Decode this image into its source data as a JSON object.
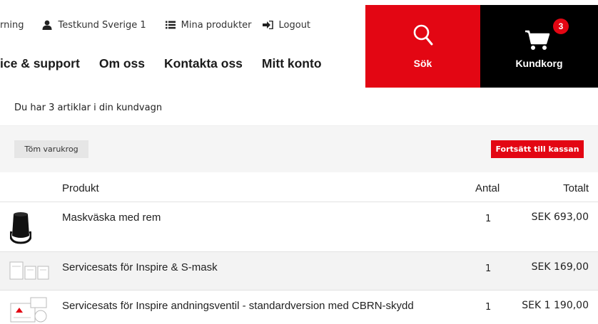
{
  "header": {
    "util_links": {
      "learning": "rning",
      "user": "Testkund Sverige 1",
      "my_products": "Mina produkter",
      "logout": "Logout"
    },
    "nav": {
      "service": "ice & support",
      "about": "Om oss",
      "contact": "Kontakta oss",
      "account": "Mitt konto"
    },
    "search_label": "Sök",
    "cart_label": "Kundkorg",
    "cart_count": "3"
  },
  "cart": {
    "info_text": "Du har 3 artiklar i din kundvagn",
    "empty_button": "Töm varukrog",
    "checkout_button": "Fortsätt till kassan",
    "columns": {
      "product": "Produkt",
      "quantity": "Antal",
      "total": "Totalt"
    },
    "items": [
      {
        "name": "Maskväska med rem",
        "quantity": "1",
        "total": "SEK 693,00"
      },
      {
        "name": "Servicesats för Inspire & S-mask",
        "quantity": "1",
        "total": "SEK 169,00"
      },
      {
        "name": "Servicesats för Inspire andningsventil - standardversion med CBRN-skydd",
        "quantity": "1",
        "total": "SEK 1 190,00"
      }
    ]
  },
  "colors": {
    "brand_red": "#e30613",
    "black": "#000000"
  }
}
